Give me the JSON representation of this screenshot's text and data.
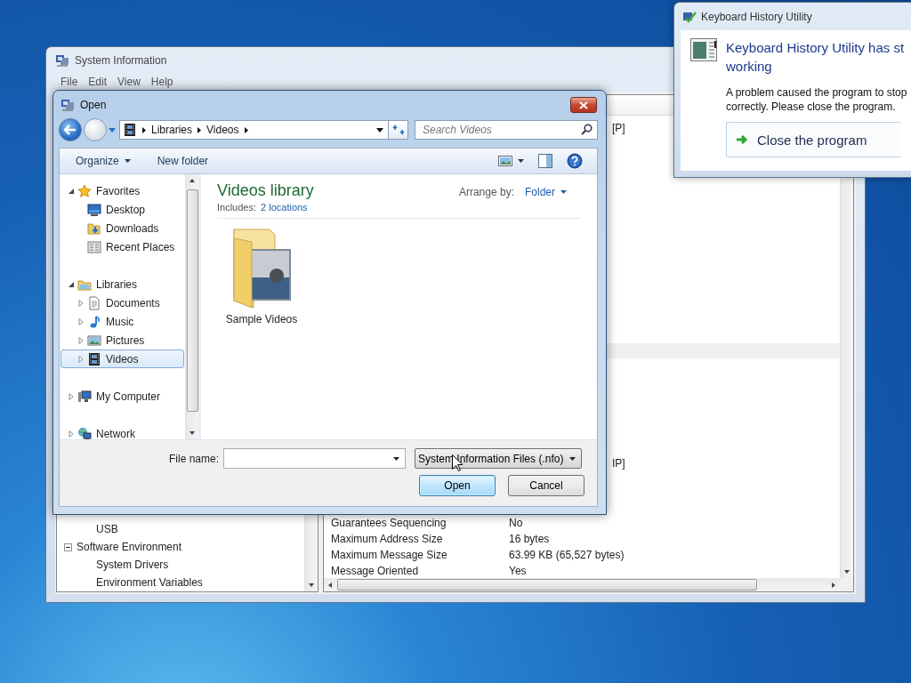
{
  "system_information_window": {
    "title": "System Information",
    "menu": [
      "File",
      "Edit",
      "View",
      "Help"
    ],
    "tree": [
      {
        "children": [
          {
            "label": "USB"
          }
        ]
      },
      {
        "label": "Software Environment",
        "expanded": true,
        "children": [
          {
            "label": "System Drivers"
          },
          {
            "label": "Environment Variables"
          }
        ]
      }
    ],
    "detail_fragments": [
      "[P]",
      "IP]"
    ],
    "rows": [
      {
        "name": "Guarantees Sequencing",
        "value": "No"
      },
      {
        "name": "Maximum Address Size",
        "value": "16 bytes"
      },
      {
        "name": "Maximum Message Size",
        "value": "63.99 KB (65,527 bytes)"
      },
      {
        "name": "Message Oriented",
        "value": "Yes"
      }
    ]
  },
  "open_dialog": {
    "title": "Open",
    "breadcrumb": [
      "Libraries",
      "Videos"
    ],
    "search": {
      "placeholder": "Search Videos"
    },
    "toolbar": {
      "organize": "Organize",
      "new_folder": "New folder"
    },
    "nav": [
      {
        "label": "Favorites",
        "kind": "favorites",
        "expanded": true,
        "selected": false,
        "children": [
          {
            "label": "Desktop",
            "kind": "desktop",
            "selected": false
          },
          {
            "label": "Downloads",
            "kind": "downloads",
            "selected": false
          },
          {
            "label": "Recent Places",
            "kind": "recent",
            "selected": false
          }
        ]
      },
      {
        "label": "Libraries",
        "kind": "libraries",
        "expanded": true,
        "selected": false,
        "children": [
          {
            "label": "Documents",
            "kind": "documents",
            "expanded": false,
            "selected": false
          },
          {
            "label": "Music",
            "kind": "music",
            "expanded": false,
            "selected": false
          },
          {
            "label": "Pictures",
            "kind": "pictures",
            "expanded": false,
            "selected": false
          },
          {
            "label": "Videos",
            "kind": "videos",
            "expanded": false,
            "selected": true
          }
        ]
      },
      {
        "label": "My Computer",
        "kind": "computer",
        "expanded": false,
        "selected": false
      },
      {
        "label": "Network",
        "kind": "network",
        "expanded": false,
        "selected": false
      }
    ],
    "library": {
      "title": "Videos library",
      "includes_label": "Includes:",
      "includes_link": "2 locations",
      "arrange_label": "Arrange by:",
      "arrange_value": "Folder"
    },
    "items": [
      {
        "name": "Sample Videos"
      }
    ],
    "file_name_label": "File name:",
    "file_type": "System Information Files (.nfo)",
    "buttons": [
      "Open",
      "Cancel"
    ]
  },
  "error_dialog": {
    "title": "Keyboard History Utility",
    "heading_lines": [
      "Keyboard History Utility has st",
      "working"
    ],
    "message_lines": [
      "A problem caused the program to stop",
      "correctly. Please close the program."
    ],
    "action": "Close the program"
  }
}
